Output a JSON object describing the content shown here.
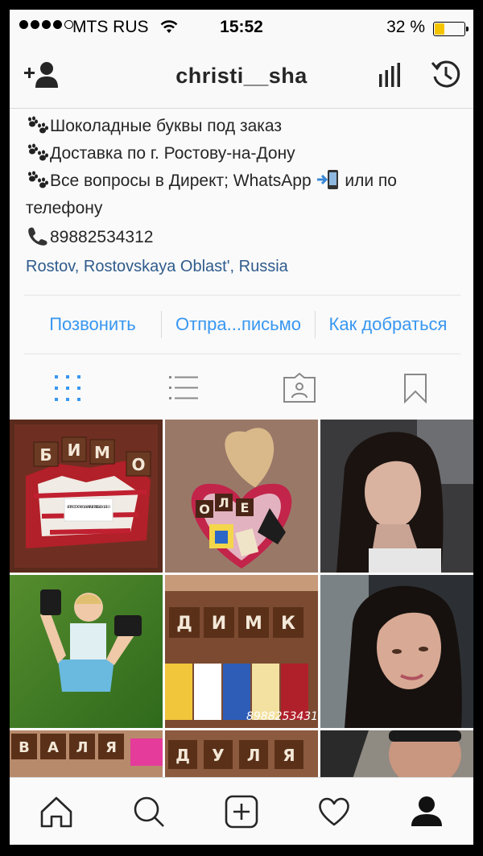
{
  "status_bar": {
    "carrier": "MTS RUS",
    "time": "15:52",
    "battery": "32 %",
    "battery_level": 0.32
  },
  "header": {
    "username": "christi__sha",
    "icons": [
      "add-user-icon",
      "insights-icon",
      "history-icon"
    ]
  },
  "bio": {
    "line1": "Шоколадные буквы под заказ",
    "line2": "Доставка по г. Ростову-на-Дону",
    "line3a": "Все вопросы в Директ; WhatsApp",
    "line3b": "или по телефону",
    "phone": "89882534312",
    "location": "Rostov, Rostovskaya Oblast', Russia"
  },
  "actions": {
    "call": "Позвонить",
    "email": "Отпра...письмо",
    "directions": "Как добраться"
  },
  "view_tabs": [
    "grid-icon",
    "list-icon",
    "tagged-icon",
    "saved-icon"
  ],
  "grid_posts": {
    "p1_letters": [
      "Б",
      "И",
      "М",
      "О"
    ],
    "p1_note": "Я ПРОСТО ХОЧУ СКАЗАТЬ ЧТО Я ТЕБЯ ЛЮБЛЮ",
    "p2_letters": [
      "О",
      "Л",
      "Е"
    ],
    "p5_letters": [
      "Д",
      "И",
      "М",
      "К"
    ],
    "p5_watermark": "89882534312",
    "p7_letters": [
      "В",
      "А",
      "Л",
      "Я"
    ],
    "p8_letters": [
      "Д",
      "У",
      "Л",
      "Я"
    ]
  },
  "tab_bar": [
    "home-icon",
    "search-icon",
    "add-post-icon",
    "activity-icon",
    "profile-icon"
  ],
  "colors": {
    "link": "#2f5b8c",
    "action": "#3897f0",
    "active_tab": "#3897f0",
    "battery": "#f5c400"
  }
}
